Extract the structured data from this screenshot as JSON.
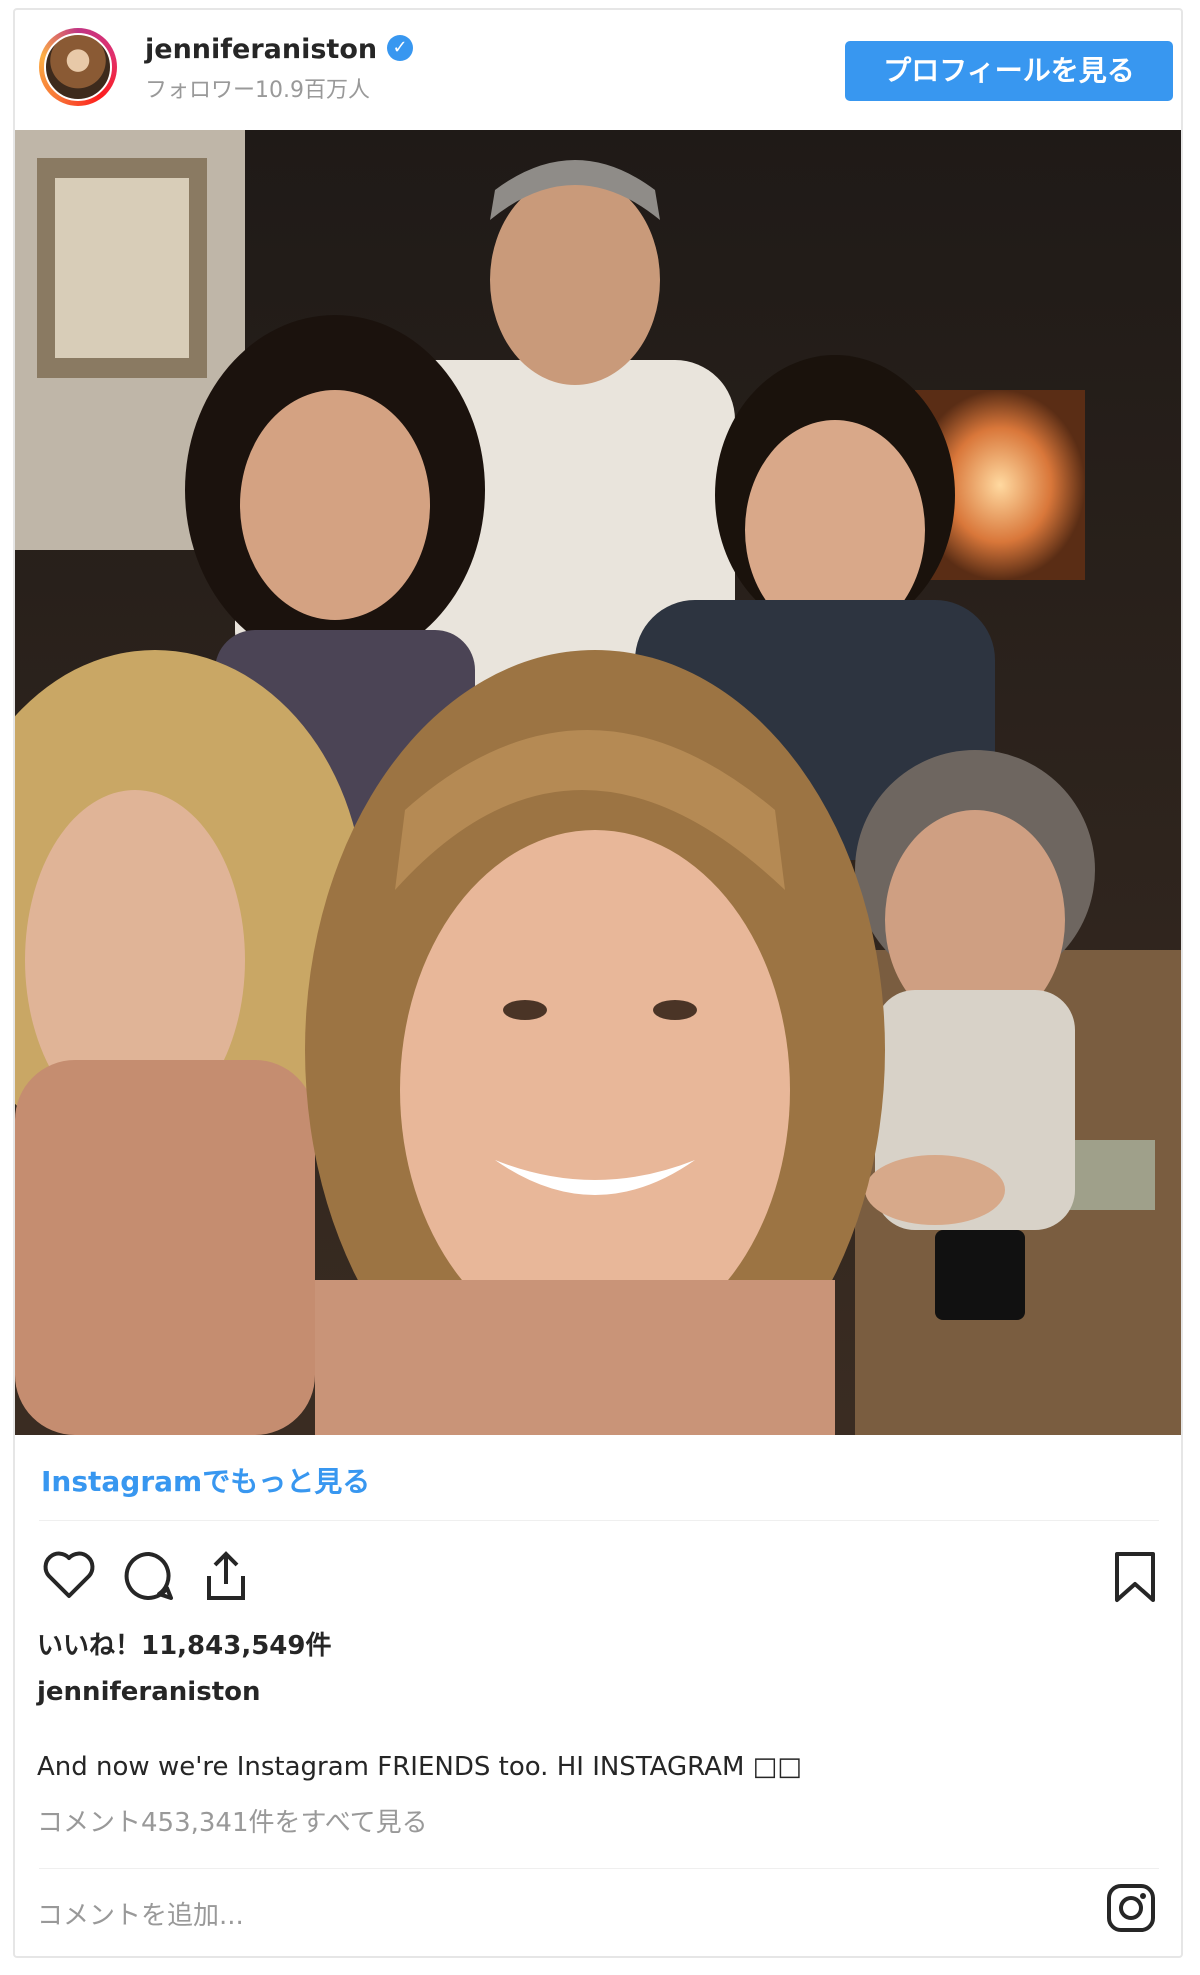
{
  "header": {
    "username": "jenniferaniston",
    "verified_icon": "✓",
    "followers": "フォロワー10.9百万人",
    "profile_button": "プロフィールを見る"
  },
  "photo": {
    "description_icon": "group-selfie-photo"
  },
  "more_link": "Instagramでもっと見る",
  "actions": {
    "like_icon": "heart-icon",
    "comment_icon": "comment-icon",
    "share_icon": "share-icon",
    "save_icon": "bookmark-icon"
  },
  "likes": "いいね！11,843,549件",
  "caption": {
    "username": "jenniferaniston",
    "text": "And now we're Instagram FRIENDS too. HI INSTAGRAM □□"
  },
  "view_comments": "コメント453,341件をすべて見る",
  "add_comment_placeholder": "コメントを追加...",
  "colors": {
    "accent": "#3897f0",
    "text": "#262626",
    "muted": "#999999"
  }
}
